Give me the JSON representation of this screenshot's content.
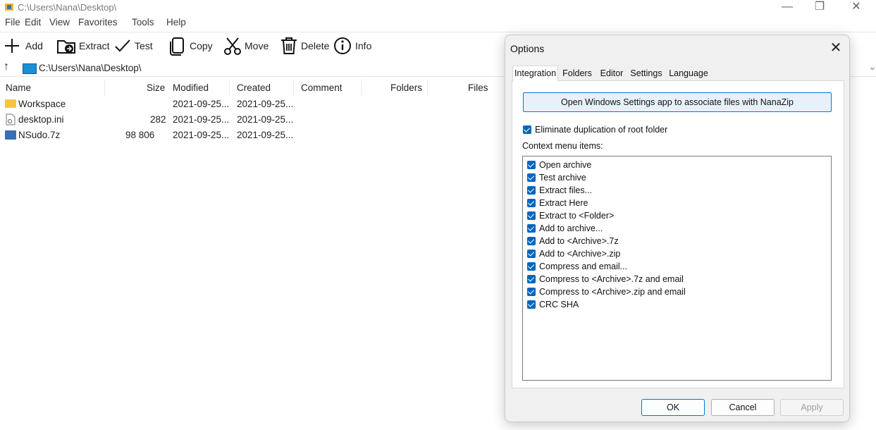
{
  "window": {
    "title": "C:\\Users\\Nana\\Desktop\\",
    "controls": {
      "minimize": "—",
      "maximize": "❐",
      "close": "✕"
    }
  },
  "menu": [
    "File",
    "Edit",
    "View",
    "Favorites",
    "Tools",
    "Help"
  ],
  "toolbar": {
    "add": "Add",
    "extract": "Extract",
    "test": "Test",
    "copy": "Copy",
    "move": "Move",
    "delete": "Delete",
    "info": "Info"
  },
  "address": {
    "path": "C:\\Users\\Nana\\Desktop\\",
    "up_icon": "↑",
    "dropdown_icon": "⌄"
  },
  "columns": [
    "Name",
    "Size",
    "Modified",
    "Created",
    "Comment",
    "Folders",
    "Files"
  ],
  "files": [
    {
      "name": "Workspace",
      "size": "",
      "modified": "2021-09-25...",
      "created": "2021-09-25...",
      "icon": "folder-icon"
    },
    {
      "name": "desktop.ini",
      "size": "282",
      "modified": "2021-09-25...",
      "created": "2021-09-25...",
      "icon": "ini-file-icon"
    },
    {
      "name": "NSudo.7z",
      "size": "98 806",
      "modified": "2021-09-25...",
      "created": "2021-09-25...",
      "icon": "archive-icon"
    }
  ],
  "dialog": {
    "title": "Options",
    "close": "✕",
    "tabs": [
      "Integration",
      "Folders",
      "Editor",
      "Settings",
      "Language"
    ],
    "active_tab": "Integration",
    "associate_button": "Open Windows Settings app to associate files with NanaZip",
    "eliminate_label": "Eliminate duplication of root folder",
    "eliminate_checked": true,
    "context_label": "Context menu items:",
    "context_items": [
      "Open archive",
      "Test archive",
      "Extract files...",
      "Extract Here",
      "Extract to <Folder>",
      "Add to archive...",
      "Add to <Archive>.7z",
      "Add to <Archive>.zip",
      "Compress and email...",
      "Compress to <Archive>.7z and email",
      "Compress to <Archive>.zip and email",
      "CRC SHA"
    ],
    "buttons": {
      "ok": "OK",
      "cancel": "Cancel",
      "apply": "Apply"
    }
  },
  "colors": {
    "accent": "#0067c0",
    "folder": "#f5c542",
    "archive": "#3b6fb6"
  }
}
